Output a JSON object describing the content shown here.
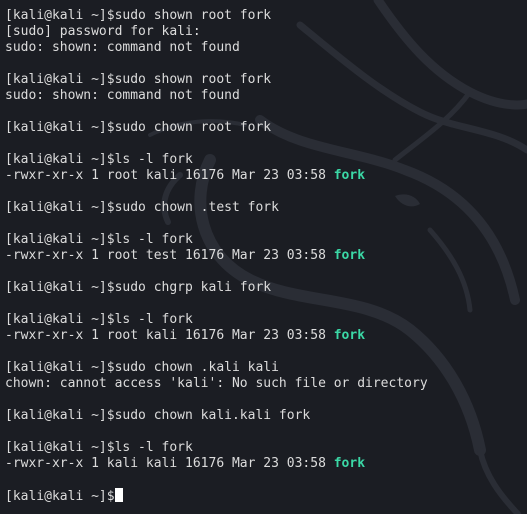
{
  "terminal": {
    "colors": {
      "background": "#1b1d23",
      "text": "#dcdcdc",
      "executable": "#3bd8a6",
      "cursor": "#ffffff"
    },
    "background_icon": "kali-dragon-watermark",
    "lines": [
      {
        "segments": [
          {
            "text": "[kali@kali ~]$sudo shown root fork"
          }
        ]
      },
      {
        "segments": [
          {
            "text": "[sudo] password for kali:"
          }
        ]
      },
      {
        "segments": [
          {
            "text": "sudo: shown: command not found"
          }
        ]
      },
      {
        "segments": [
          {
            "text": ""
          }
        ]
      },
      {
        "segments": [
          {
            "text": "[kali@kali ~]$sudo shown root fork"
          }
        ]
      },
      {
        "segments": [
          {
            "text": "sudo: shown: command not found"
          }
        ]
      },
      {
        "segments": [
          {
            "text": ""
          }
        ]
      },
      {
        "segments": [
          {
            "text": "[kali@kali ~]$sudo chown root fork"
          }
        ]
      },
      {
        "segments": [
          {
            "text": ""
          }
        ]
      },
      {
        "segments": [
          {
            "text": "[kali@kali ~]$ls -l fork"
          }
        ]
      },
      {
        "segments": [
          {
            "text": "-rwxr-xr-x 1 root kali 16176 Mar 23 03:58 "
          },
          {
            "text": "fork",
            "style": "exec"
          }
        ]
      },
      {
        "segments": [
          {
            "text": ""
          }
        ]
      },
      {
        "segments": [
          {
            "text": "[kali@kali ~]$sudo chown .test fork"
          }
        ]
      },
      {
        "segments": [
          {
            "text": ""
          }
        ]
      },
      {
        "segments": [
          {
            "text": "[kali@kali ~]$ls -l fork"
          }
        ]
      },
      {
        "segments": [
          {
            "text": "-rwxr-xr-x 1 root test 16176 Mar 23 03:58 "
          },
          {
            "text": "fork",
            "style": "exec"
          }
        ]
      },
      {
        "segments": [
          {
            "text": ""
          }
        ]
      },
      {
        "segments": [
          {
            "text": "[kali@kali ~]$sudo chgrp kali fork"
          }
        ]
      },
      {
        "segments": [
          {
            "text": ""
          }
        ]
      },
      {
        "segments": [
          {
            "text": "[kali@kali ~]$ls -l fork"
          }
        ]
      },
      {
        "segments": [
          {
            "text": "-rwxr-xr-x 1 root kali 16176 Mar 23 03:58 "
          },
          {
            "text": "fork",
            "style": "exec"
          }
        ]
      },
      {
        "segments": [
          {
            "text": ""
          }
        ]
      },
      {
        "segments": [
          {
            "text": "[kali@kali ~]$sudo chown .kali kali"
          }
        ]
      },
      {
        "segments": [
          {
            "text": "chown: cannot access 'kali': No such file or directory"
          }
        ]
      },
      {
        "segments": [
          {
            "text": ""
          }
        ]
      },
      {
        "segments": [
          {
            "text": "[kali@kali ~]$sudo chown kali.kali fork"
          }
        ]
      },
      {
        "segments": [
          {
            "text": ""
          }
        ]
      },
      {
        "segments": [
          {
            "text": "[kali@kali ~]$ls -l fork"
          }
        ]
      },
      {
        "segments": [
          {
            "text": "-rwxr-xr-x 1 kali kali 16176 Mar 23 03:58 "
          },
          {
            "text": "fork",
            "style": "exec"
          }
        ]
      },
      {
        "segments": [
          {
            "text": ""
          }
        ]
      },
      {
        "segments": [
          {
            "text": "[kali@kali ~]$"
          }
        ],
        "cursor": true
      }
    ]
  }
}
